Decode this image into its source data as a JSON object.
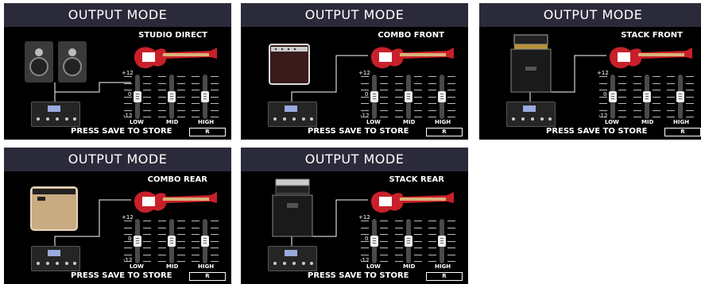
{
  "panels": [
    {
      "title": "OUTPUT MODE",
      "mode": "STUDIO DIRECT",
      "save": "PRESS SAVE TO STORE",
      "r": "R",
      "device": "monitors"
    },
    {
      "title": "OUTPUT MODE",
      "mode": "COMBO FRONT",
      "save": "PRESS SAVE TO STORE",
      "r": "R",
      "device": "combo-front"
    },
    {
      "title": "OUTPUT MODE",
      "mode": "STACK FRONT",
      "save": "PRESS SAVE TO STORE",
      "r": "R",
      "device": "stack-front"
    },
    {
      "title": "OUTPUT MODE",
      "mode": "COMBO REAR",
      "save": "PRESS SAVE TO STORE",
      "r": "R",
      "device": "combo-rear"
    },
    {
      "title": "OUTPUT MODE",
      "mode": "STACK REAR",
      "save": "PRESS SAVE TO STORE",
      "r": "R",
      "device": "stack-rear"
    }
  ],
  "eq": {
    "top": "+12",
    "mid": "0",
    "bottom": "-12",
    "low": "LOW",
    "mid_label": "MID",
    "high": "HIGH"
  },
  "colors": {
    "header_bg": "#2a2a3a",
    "guitar_body": "#c8202a",
    "panel_bg": "#000000"
  }
}
